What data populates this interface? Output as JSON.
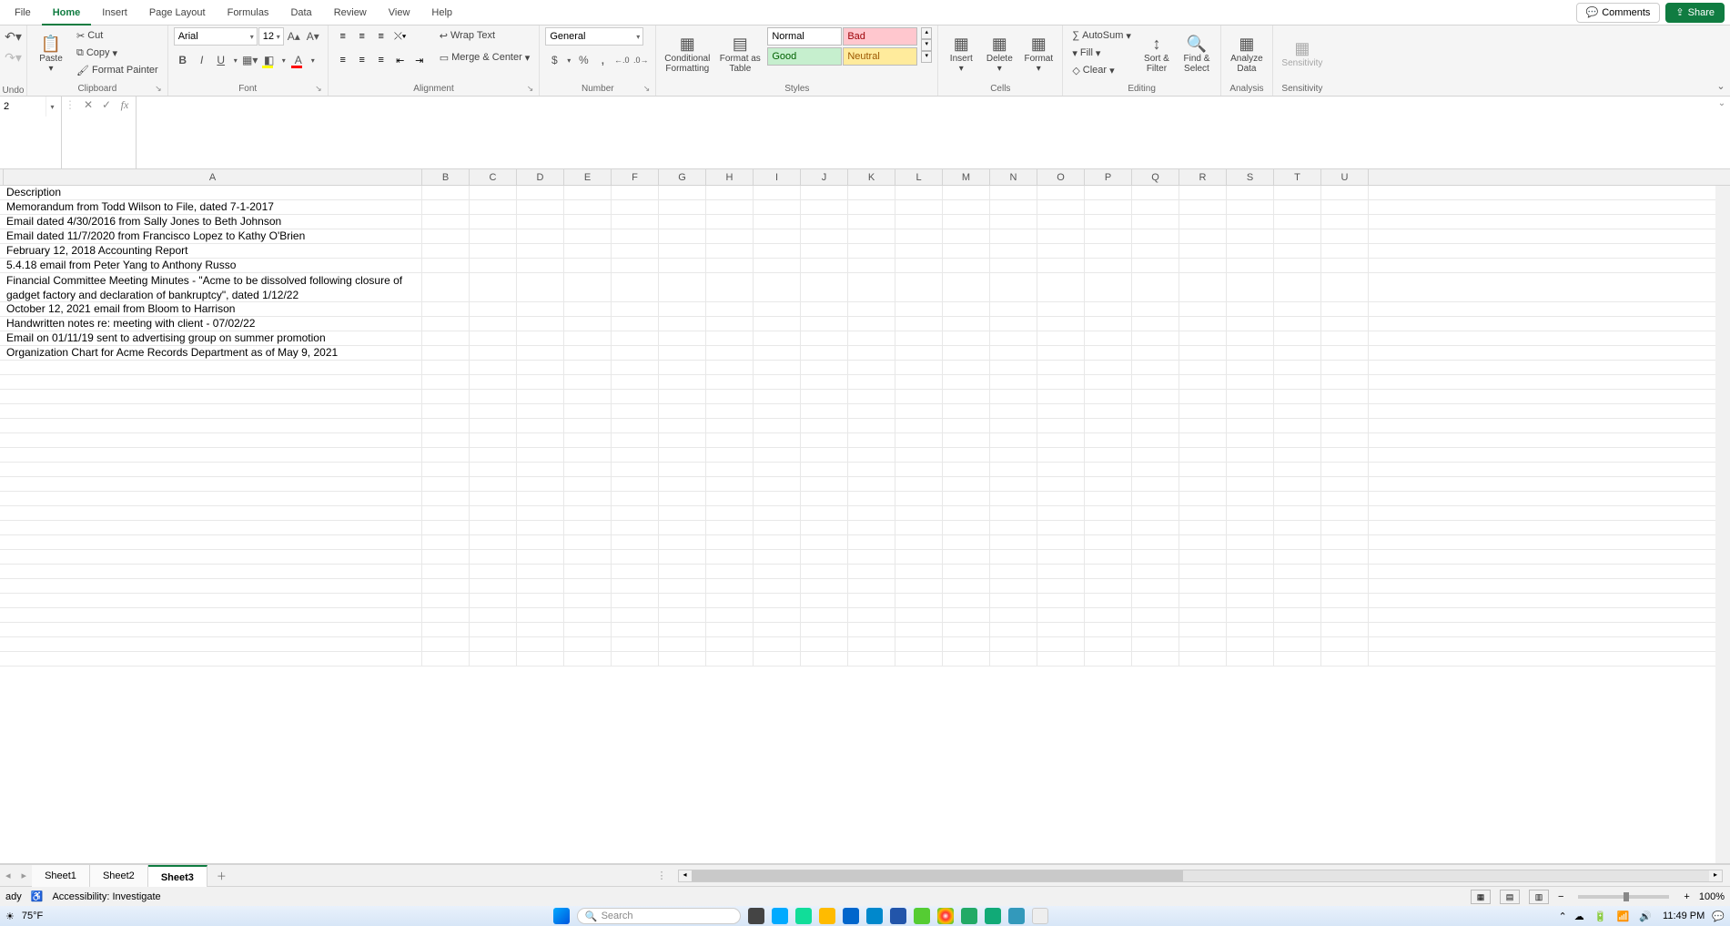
{
  "tabs": {
    "list": [
      "File",
      "Home",
      "Insert",
      "Page Layout",
      "Formulas",
      "Data",
      "Review",
      "View",
      "Help"
    ],
    "active": 1
  },
  "top_right": {
    "comments": "Comments",
    "share": "Share"
  },
  "ribbon": {
    "undo": {
      "label": "Undo"
    },
    "clipboard": {
      "label": "Clipboard",
      "paste": "Paste",
      "cut": "Cut",
      "copy": "Copy",
      "painter": "Format Painter"
    },
    "font": {
      "label": "Font",
      "name": "Arial",
      "size": "12",
      "bold": "B",
      "italic": "I",
      "underline": "U"
    },
    "alignment": {
      "label": "Alignment",
      "wrap": "Wrap Text",
      "merge": "Merge & Center"
    },
    "number": {
      "label": "Number",
      "format": "General",
      "currency": "$",
      "percent": "%",
      "comma": ",",
      "incdec": ".00",
      "decdec": ".0"
    },
    "styles": {
      "label": "Styles",
      "cond": "Conditional\nFormatting",
      "table": "Format as\nTable",
      "normal": "Normal",
      "bad": "Bad",
      "good": "Good",
      "neutral": "Neutral"
    },
    "cells": {
      "label": "Cells",
      "insert": "Insert",
      "delete": "Delete",
      "format": "Format"
    },
    "editing": {
      "label": "Editing",
      "autosum": "AutoSum",
      "fill": "Fill",
      "clear": "Clear",
      "sort": "Sort &\nFilter",
      "find": "Find &\nSelect"
    },
    "analysis": {
      "label": "Analysis",
      "analyze": "Analyze\nData"
    },
    "sensitivity": {
      "label": "Sensitivity",
      "btn": "Sensitivity"
    }
  },
  "namebox": "2",
  "fx": "",
  "columns": [
    "A",
    "B",
    "C",
    "D",
    "E",
    "F",
    "G",
    "H",
    "I",
    "J",
    "K",
    "L",
    "M",
    "N",
    "O",
    "P",
    "Q",
    "R",
    "S",
    "T",
    "U"
  ],
  "rows": [
    {
      "a": "Description"
    },
    {
      "a": "Memorandum from Todd Wilson to File, dated 7-1-2017"
    },
    {
      "a": "Email dated 4/30/2016 from Sally Jones to Beth Johnson"
    },
    {
      "a": "Email dated 11/7/2020 from Francisco Lopez to Kathy O'Brien"
    },
    {
      "a": "February 12, 2018 Accounting Report"
    },
    {
      "a": "5.4.18 email from Peter Yang to Anthony Russo"
    },
    {
      "a": "Financial Committee Meeting Minutes - \"Acme to be dissolved following closure of gadget factory and declaration of bankruptcy\", dated 1/12/22",
      "wrap": true
    },
    {
      "a": "October 12, 2021 email from Bloom to Harrison"
    },
    {
      "a": "Handwritten notes re: meeting with client - 07/02/22"
    },
    {
      "a": "Email on 01/11/19 sent to advertising group on summer promotion"
    },
    {
      "a": "Organization Chart for Acme Records Department as of May 9, 2021"
    }
  ],
  "blank_rows": 21,
  "sheet_tabs": {
    "list": [
      "Sheet1",
      "Sheet2",
      "Sheet3"
    ],
    "active": 2
  },
  "status": {
    "ready": "ady",
    "access": "Accessibility: Investigate",
    "zoom": "100%"
  },
  "taskbar": {
    "temp": "75°F",
    "search_ph": "Search",
    "time": "11:49 PM"
  }
}
